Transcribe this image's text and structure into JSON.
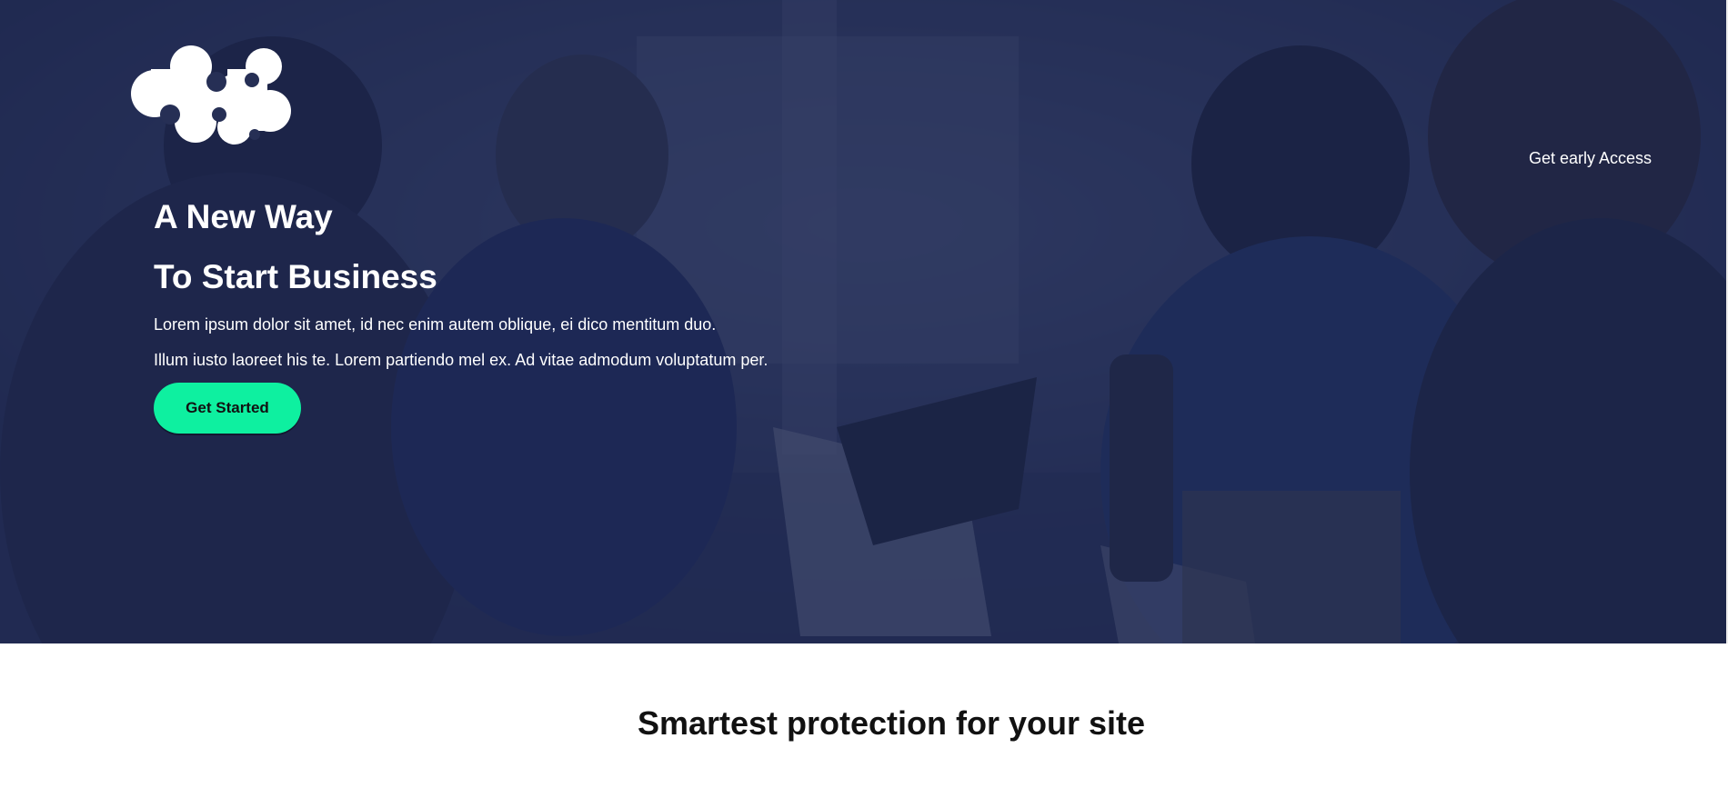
{
  "colors": {
    "overlay": "#1b244a",
    "accent": "#0ef0a0",
    "text_light": "#ffffff",
    "text_dark": "#111111"
  },
  "header": {
    "logo_icon": "molecule-logo-icon",
    "early_access_label": "Get early Access"
  },
  "hero": {
    "title_line1": "A New Way",
    "title_line2": "To Start Business",
    "text_line1": "Lorem ipsum dolor sit amet, id nec enim autem oblique, ei dico mentitum duo.",
    "text_line2": "Illum iusto laoreet his te. Lorem partiendo mel ex. Ad vitae admodum voluptatum per.",
    "cta_label": "Get Started"
  },
  "section": {
    "title": "Smartest protection for your site"
  }
}
